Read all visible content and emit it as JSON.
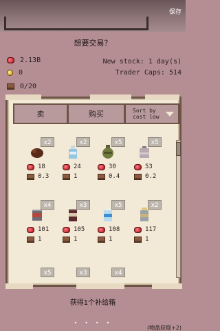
{
  "top": {
    "save_label": "保存"
  },
  "dialog": {
    "title": "想要交易？"
  },
  "resources": {
    "gems": "2.13B",
    "coins": "0",
    "capacity": "0/20"
  },
  "trader": {
    "new_stock": "New stock: 1 day(s)",
    "caps": "Trader Caps: 514"
  },
  "tabs": {
    "sell": "卖",
    "buy": "购买",
    "sort": "Sort by cost low"
  },
  "items": [
    {
      "badge": "x2",
      "price": "18",
      "weight": "0.3",
      "icon": "meat-icon"
    },
    {
      "badge": "x2",
      "price": "24",
      "weight": "1",
      "icon": "water-bottle-icon"
    },
    {
      "badge": "x5",
      "price": "30",
      "weight": "0.4",
      "icon": "grenade-icon"
    },
    {
      "badge": "x5",
      "price": "53",
      "weight": "0.2",
      "icon": "battery-icon"
    },
    {
      "badge": "x4",
      "price": "101",
      "weight": "1",
      "icon": "canned-food-icon"
    },
    {
      "badge": "x3",
      "price": "105",
      "weight": "1",
      "icon": "cola-can-icon"
    },
    {
      "badge": "x5",
      "price": "108",
      "weight": "1",
      "icon": "purified-water-icon"
    },
    {
      "badge": "x2",
      "price": "117",
      "weight": "1",
      "icon": "jar-icon"
    },
    {
      "badge": "x5",
      "price": "",
      "weight": "",
      "icon": "item-icon"
    },
    {
      "badge": "x3",
      "price": "",
      "weight": "",
      "icon": "item-icon"
    },
    {
      "badge": "x4",
      "price": "",
      "weight": "",
      "icon": "item-icon"
    }
  ],
  "bottom": {
    "message": "获得1个补给箱",
    "dots": "• • • •",
    "hint": "(物品获取+2)"
  },
  "colors": {
    "background": "#b48e92",
    "panel": "#f2e9d6",
    "tab": "#b89a9d",
    "badge": "#bdb6ad"
  }
}
